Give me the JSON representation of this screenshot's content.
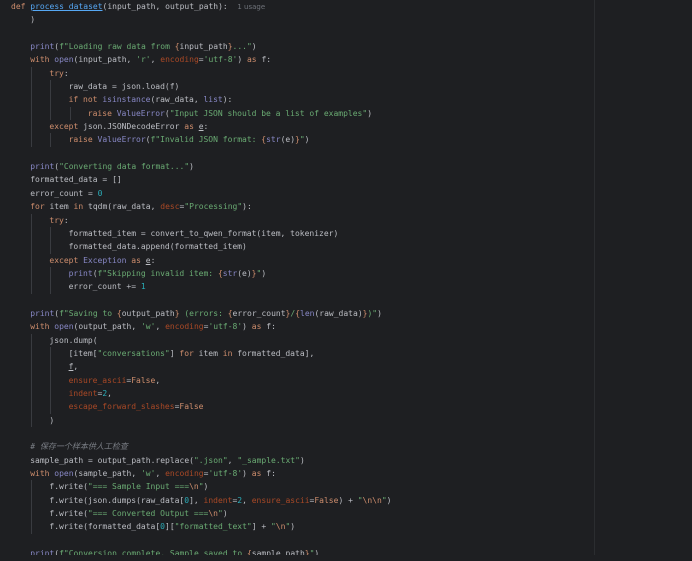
{
  "editor": {
    "language": "python",
    "function_name": "process_dataset",
    "usage_hint": "1 usage",
    "lines": [
      {
        "indent": 0,
        "tokens": [
          {
            "t": "kw",
            "v": "def "
          },
          {
            "t": "fn-u",
            "v": "process_dataset"
          },
          {
            "t": "plain",
            "v": "(input_path, output_path):  "
          },
          {
            "t": "hint",
            "v": "1 usage"
          }
        ]
      },
      {
        "indent": 1,
        "tokens": [
          {
            "t": "plain",
            "v": ")"
          }
        ]
      },
      {
        "indent": 0,
        "tokens": []
      },
      {
        "indent": 1,
        "tokens": [
          {
            "t": "bi",
            "v": "print"
          },
          {
            "t": "plain",
            "v": "("
          },
          {
            "t": "str",
            "v": "f\"Loading raw data from "
          },
          {
            "t": "fstr-brace",
            "v": "{"
          },
          {
            "t": "plain",
            "v": "input_path"
          },
          {
            "t": "fstr-brace",
            "v": "}"
          },
          {
            "t": "str",
            "v": "...\""
          },
          {
            "t": "plain",
            "v": ")"
          }
        ]
      },
      {
        "indent": 1,
        "tokens": [
          {
            "t": "kw",
            "v": "with "
          },
          {
            "t": "bi",
            "v": "open"
          },
          {
            "t": "plain",
            "v": "(input_path, "
          },
          {
            "t": "str",
            "v": "'r'"
          },
          {
            "t": "plain",
            "v": ", "
          },
          {
            "t": "param",
            "v": "encoding"
          },
          {
            "t": "plain",
            "v": "="
          },
          {
            "t": "str",
            "v": "'utf-8'"
          },
          {
            "t": "plain",
            "v": ") "
          },
          {
            "t": "kw",
            "v": "as "
          },
          {
            "t": "plain",
            "v": "f:"
          }
        ]
      },
      {
        "indent": 2,
        "tokens": [
          {
            "t": "kw",
            "v": "try"
          },
          {
            "t": "plain",
            "v": ":"
          }
        ]
      },
      {
        "indent": 3,
        "tokens": [
          {
            "t": "plain",
            "v": "raw_data = json.load(f)"
          }
        ]
      },
      {
        "indent": 3,
        "tokens": [
          {
            "t": "kw",
            "v": "if not "
          },
          {
            "t": "bi",
            "v": "isinstance"
          },
          {
            "t": "plain",
            "v": "(raw_data, "
          },
          {
            "t": "bi",
            "v": "list"
          },
          {
            "t": "plain",
            "v": "):"
          }
        ]
      },
      {
        "indent": 4,
        "tokens": [
          {
            "t": "kw",
            "v": "raise "
          },
          {
            "t": "bi",
            "v": "ValueError"
          },
          {
            "t": "plain",
            "v": "("
          },
          {
            "t": "str",
            "v": "\"Input JSON should be a list of examples\""
          },
          {
            "t": "plain",
            "v": ")"
          }
        ]
      },
      {
        "indent": 2,
        "tokens": [
          {
            "t": "kw",
            "v": "except "
          },
          {
            "t": "plain",
            "v": "json.JSONDecodeError "
          },
          {
            "t": "kw",
            "v": "as "
          },
          {
            "t": "under",
            "v": "e"
          },
          {
            "t": "plain",
            "v": ":"
          }
        ]
      },
      {
        "indent": 3,
        "tokens": [
          {
            "t": "kw",
            "v": "raise "
          },
          {
            "t": "bi",
            "v": "ValueError"
          },
          {
            "t": "plain",
            "v": "("
          },
          {
            "t": "str",
            "v": "f\"Invalid JSON format: "
          },
          {
            "t": "fstr-brace",
            "v": "{"
          },
          {
            "t": "bi",
            "v": "str"
          },
          {
            "t": "plain",
            "v": "(e)"
          },
          {
            "t": "fstr-brace",
            "v": "}"
          },
          {
            "t": "str",
            "v": "\""
          },
          {
            "t": "plain",
            "v": ")"
          }
        ]
      },
      {
        "indent": 0,
        "tokens": []
      },
      {
        "indent": 1,
        "tokens": [
          {
            "t": "bi",
            "v": "print"
          },
          {
            "t": "plain",
            "v": "("
          },
          {
            "t": "str",
            "v": "\"Converting data format...\""
          },
          {
            "t": "plain",
            "v": ")"
          }
        ]
      },
      {
        "indent": 1,
        "tokens": [
          {
            "t": "plain",
            "v": "formatted_data = []"
          }
        ]
      },
      {
        "indent": 1,
        "tokens": [
          {
            "t": "plain",
            "v": "error_count = "
          },
          {
            "t": "num",
            "v": "0"
          }
        ]
      },
      {
        "indent": 1,
        "tokens": [
          {
            "t": "kw",
            "v": "for "
          },
          {
            "t": "plain",
            "v": "item "
          },
          {
            "t": "kw",
            "v": "in "
          },
          {
            "t": "plain",
            "v": "tqdm(raw_data, "
          },
          {
            "t": "param",
            "v": "desc"
          },
          {
            "t": "plain",
            "v": "="
          },
          {
            "t": "str",
            "v": "\"Processing\""
          },
          {
            "t": "plain",
            "v": "):"
          }
        ]
      },
      {
        "indent": 2,
        "tokens": [
          {
            "t": "kw",
            "v": "try"
          },
          {
            "t": "plain",
            "v": ":"
          }
        ]
      },
      {
        "indent": 3,
        "tokens": [
          {
            "t": "plain",
            "v": "formatted_item = convert_to_qwen_format(item, tokenizer)"
          }
        ]
      },
      {
        "indent": 3,
        "tokens": [
          {
            "t": "plain",
            "v": "formatted_data.append(formatted_item)"
          }
        ]
      },
      {
        "indent": 2,
        "tokens": [
          {
            "t": "kw",
            "v": "except "
          },
          {
            "t": "bi",
            "v": "Exception "
          },
          {
            "t": "kw",
            "v": "as "
          },
          {
            "t": "under",
            "v": "e"
          },
          {
            "t": "plain",
            "v": ":"
          }
        ]
      },
      {
        "indent": 3,
        "tokens": [
          {
            "t": "bi",
            "v": "print"
          },
          {
            "t": "plain",
            "v": "("
          },
          {
            "t": "str",
            "v": "f\"Skipping invalid item: "
          },
          {
            "t": "fstr-brace",
            "v": "{"
          },
          {
            "t": "bi",
            "v": "str"
          },
          {
            "t": "plain",
            "v": "(e)"
          },
          {
            "t": "fstr-brace",
            "v": "}"
          },
          {
            "t": "str",
            "v": "\""
          },
          {
            "t": "plain",
            "v": ")"
          }
        ]
      },
      {
        "indent": 3,
        "tokens": [
          {
            "t": "plain",
            "v": "error_count += "
          },
          {
            "t": "num",
            "v": "1"
          }
        ]
      },
      {
        "indent": 0,
        "tokens": []
      },
      {
        "indent": 1,
        "tokens": [
          {
            "t": "bi",
            "v": "print"
          },
          {
            "t": "plain",
            "v": "("
          },
          {
            "t": "str",
            "v": "f\"Saving to "
          },
          {
            "t": "fstr-brace",
            "v": "{"
          },
          {
            "t": "plain",
            "v": "output_path"
          },
          {
            "t": "fstr-brace",
            "v": "}"
          },
          {
            "t": "str",
            "v": " (errors: "
          },
          {
            "t": "fstr-brace",
            "v": "{"
          },
          {
            "t": "plain",
            "v": "error_count"
          },
          {
            "t": "fstr-brace",
            "v": "}"
          },
          {
            "t": "str",
            "v": "/"
          },
          {
            "t": "fstr-brace",
            "v": "{"
          },
          {
            "t": "bi",
            "v": "len"
          },
          {
            "t": "plain",
            "v": "(raw_data)"
          },
          {
            "t": "fstr-brace",
            "v": "}"
          },
          {
            "t": "str",
            "v": ")\""
          },
          {
            "t": "plain",
            "v": ")"
          }
        ]
      },
      {
        "indent": 1,
        "tokens": [
          {
            "t": "kw",
            "v": "with "
          },
          {
            "t": "bi",
            "v": "open"
          },
          {
            "t": "plain",
            "v": "(output_path, "
          },
          {
            "t": "str",
            "v": "'w'"
          },
          {
            "t": "plain",
            "v": ", "
          },
          {
            "t": "param",
            "v": "encoding"
          },
          {
            "t": "plain",
            "v": "="
          },
          {
            "t": "str",
            "v": "'utf-8'"
          },
          {
            "t": "plain",
            "v": ") "
          },
          {
            "t": "kw",
            "v": "as "
          },
          {
            "t": "plain",
            "v": "f:"
          }
        ]
      },
      {
        "indent": 2,
        "tokens": [
          {
            "t": "plain",
            "v": "json.dump("
          }
        ]
      },
      {
        "indent": 3,
        "tokens": [
          {
            "t": "plain",
            "v": "[item["
          },
          {
            "t": "str",
            "v": "\"conversations\""
          },
          {
            "t": "plain",
            "v": "] "
          },
          {
            "t": "kw",
            "v": "for "
          },
          {
            "t": "plain",
            "v": "item "
          },
          {
            "t": "kw",
            "v": "in "
          },
          {
            "t": "plain",
            "v": "formatted_data],"
          }
        ]
      },
      {
        "indent": 3,
        "tokens": [
          {
            "t": "under",
            "v": "f"
          },
          {
            "t": "plain",
            "v": ","
          }
        ]
      },
      {
        "indent": 3,
        "tokens": [
          {
            "t": "param",
            "v": "ensure_ascii"
          },
          {
            "t": "plain",
            "v": "="
          },
          {
            "t": "kw",
            "v": "False"
          },
          {
            "t": "plain",
            "v": ","
          }
        ]
      },
      {
        "indent": 3,
        "tokens": [
          {
            "t": "param",
            "v": "indent"
          },
          {
            "t": "plain",
            "v": "="
          },
          {
            "t": "num",
            "v": "2"
          },
          {
            "t": "plain",
            "v": ","
          }
        ]
      },
      {
        "indent": 3,
        "tokens": [
          {
            "t": "param",
            "v": "escape_forward_slashes"
          },
          {
            "t": "plain",
            "v": "="
          },
          {
            "t": "kw",
            "v": "False"
          }
        ]
      },
      {
        "indent": 2,
        "tokens": [
          {
            "t": "plain",
            "v": ")"
          }
        ]
      },
      {
        "indent": 0,
        "tokens": []
      },
      {
        "indent": 1,
        "tokens": [
          {
            "t": "cmt",
            "v": "# 保存一个样本供人工检查"
          }
        ]
      },
      {
        "indent": 1,
        "tokens": [
          {
            "t": "plain",
            "v": "sample_path = output_path.replace("
          },
          {
            "t": "str",
            "v": "\".json\""
          },
          {
            "t": "plain",
            "v": ", "
          },
          {
            "t": "str",
            "v": "\"_sample.txt\""
          },
          {
            "t": "plain",
            "v": ")"
          }
        ]
      },
      {
        "indent": 1,
        "tokens": [
          {
            "t": "kw",
            "v": "with "
          },
          {
            "t": "bi",
            "v": "open"
          },
          {
            "t": "plain",
            "v": "(sample_path, "
          },
          {
            "t": "str",
            "v": "'w'"
          },
          {
            "t": "plain",
            "v": ", "
          },
          {
            "t": "param",
            "v": "encoding"
          },
          {
            "t": "plain",
            "v": "="
          },
          {
            "t": "str",
            "v": "'utf-8'"
          },
          {
            "t": "plain",
            "v": ") "
          },
          {
            "t": "kw",
            "v": "as "
          },
          {
            "t": "plain",
            "v": "f:"
          }
        ]
      },
      {
        "indent": 2,
        "tokens": [
          {
            "t": "plain",
            "v": "f.write("
          },
          {
            "t": "str",
            "v": "\"=== Sample Input ==="
          },
          {
            "t": "esc",
            "v": "\\n"
          },
          {
            "t": "str",
            "v": "\""
          },
          {
            "t": "plain",
            "v": ")"
          }
        ]
      },
      {
        "indent": 2,
        "tokens": [
          {
            "t": "plain",
            "v": "f.write(json.dumps(raw_data["
          },
          {
            "t": "num",
            "v": "0"
          },
          {
            "t": "plain",
            "v": "], "
          },
          {
            "t": "param",
            "v": "indent"
          },
          {
            "t": "plain",
            "v": "="
          },
          {
            "t": "num",
            "v": "2"
          },
          {
            "t": "plain",
            "v": ", "
          },
          {
            "t": "param",
            "v": "ensure_ascii"
          },
          {
            "t": "plain",
            "v": "="
          },
          {
            "t": "kw",
            "v": "False"
          },
          {
            "t": "plain",
            "v": ") + "
          },
          {
            "t": "str",
            "v": "\""
          },
          {
            "t": "esc",
            "v": "\\n\\n"
          },
          {
            "t": "str",
            "v": "\""
          },
          {
            "t": "plain",
            "v": ")"
          }
        ]
      },
      {
        "indent": 2,
        "tokens": [
          {
            "t": "plain",
            "v": "f.write("
          },
          {
            "t": "str",
            "v": "\"=== Converted Output ==="
          },
          {
            "t": "esc",
            "v": "\\n"
          },
          {
            "t": "str",
            "v": "\""
          },
          {
            "t": "plain",
            "v": ")"
          }
        ]
      },
      {
        "indent": 2,
        "tokens": [
          {
            "t": "plain",
            "v": "f.write(formatted_data["
          },
          {
            "t": "num",
            "v": "0"
          },
          {
            "t": "plain",
            "v": "]["
          },
          {
            "t": "str",
            "v": "\"formatted_text\""
          },
          {
            "t": "plain",
            "v": "] + "
          },
          {
            "t": "str",
            "v": "\""
          },
          {
            "t": "esc",
            "v": "\\n"
          },
          {
            "t": "str",
            "v": "\""
          },
          {
            "t": "plain",
            "v": ")"
          }
        ]
      },
      {
        "indent": 0,
        "tokens": []
      },
      {
        "indent": 1,
        "tokens": [
          {
            "t": "bi",
            "v": "print"
          },
          {
            "t": "plain",
            "v": "("
          },
          {
            "t": "str",
            "v": "f\"Conversion complete. Sample saved to "
          },
          {
            "t": "fstr-brace",
            "v": "{"
          },
          {
            "t": "plain",
            "v": "sample_path"
          },
          {
            "t": "fstr-brace",
            "v": "}"
          },
          {
            "t": "str",
            "v": "\""
          },
          {
            "t": "plain",
            "v": ")"
          }
        ]
      }
    ]
  },
  "colors": {
    "background": "#1e1f22",
    "keyword": "#cf8e6d",
    "function": "#56a8f5",
    "builtin": "#8888c6",
    "string": "#6aab73",
    "number": "#2aacb8",
    "parameter": "#aa4926",
    "comment": "#7a7e85",
    "text": "#bcbec4"
  }
}
